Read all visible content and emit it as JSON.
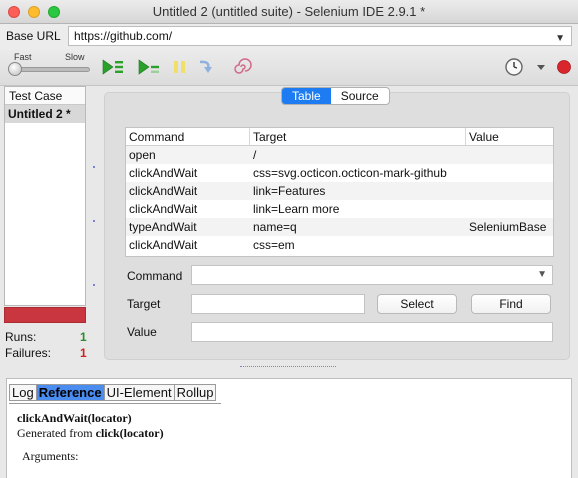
{
  "window": {
    "title": "Untitled 2 (untitled suite) - Selenium IDE 2.9.1 *"
  },
  "base_url": {
    "label": "Base URL",
    "value": "https://github.com/"
  },
  "toolbar": {
    "speed_fast": "Fast",
    "speed_slow": "Slow",
    "icons": [
      "play-all-icon",
      "play-current-icon",
      "pause-icon",
      "step-icon",
      "rollup-icon",
      "clock-icon",
      "menu-arrow-icon",
      "record-icon"
    ]
  },
  "left_pane": {
    "header": "Test Case",
    "items": [
      "Untitled 2 *"
    ],
    "runs_label": "Runs:",
    "runs_value": "1",
    "failures_label": "Failures:",
    "failures_value": "1"
  },
  "editor": {
    "tabs": [
      {
        "label": "Table",
        "active": true
      },
      {
        "label": "Source",
        "active": false
      }
    ],
    "columns": [
      "Command",
      "Target",
      "Value"
    ],
    "rows": [
      {
        "command": "open",
        "target": "/",
        "value": ""
      },
      {
        "command": "clickAndWait",
        "target": "css=svg.octicon.octicon-mark-github",
        "value": ""
      },
      {
        "command": "clickAndWait",
        "target": "link=Features",
        "value": ""
      },
      {
        "command": "clickAndWait",
        "target": "link=Learn more",
        "value": ""
      },
      {
        "command": "typeAndWait",
        "target": "name=q",
        "value": "SeleniumBase"
      },
      {
        "command": "clickAndWait",
        "target": "css=em",
        "value": ""
      }
    ],
    "command_label": "Command",
    "target_label": "Target",
    "value_label": "Value",
    "select_button": "Select",
    "find_button": "Find"
  },
  "bottom_pane": {
    "tabs": [
      {
        "label": "Log",
        "active": false
      },
      {
        "label": "Reference",
        "active": true
      },
      {
        "label": "UI-Element",
        "active": false
      },
      {
        "label": "Rollup",
        "active": false
      }
    ],
    "ref_title": "clickAndWait(locator)",
    "ref_generated_prefix": "Generated from ",
    "ref_generated_source": "click(locator)",
    "ref_args_label": "Arguments:"
  },
  "colors": {
    "accent_blue": "#1e7cf2",
    "progress_fail": "#c9363f",
    "runs_green": "#2b8a2b",
    "failures_red": "#cc2222"
  }
}
